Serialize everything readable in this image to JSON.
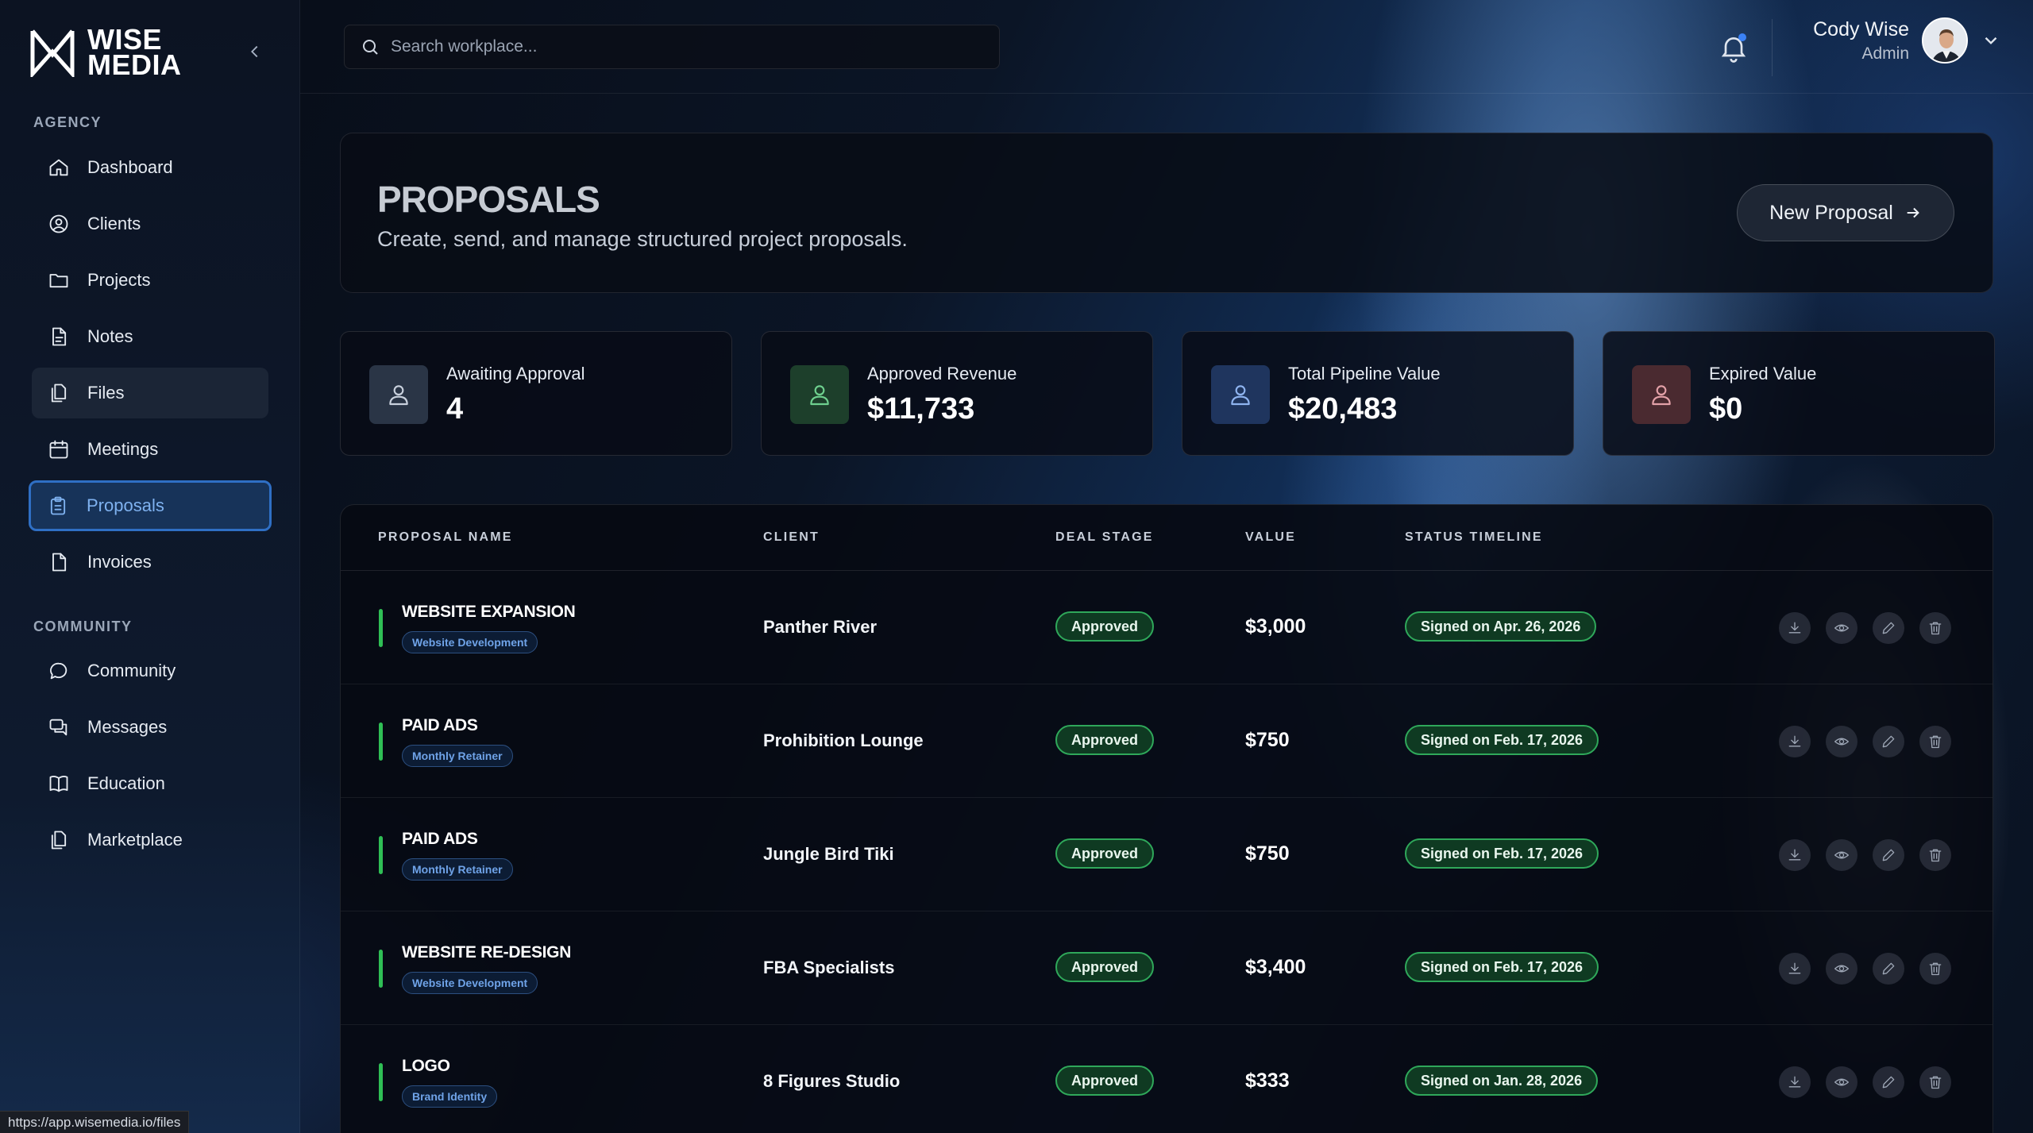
{
  "brand": {
    "line1": "WISE",
    "line2": "MEDIA"
  },
  "sidebar": {
    "agency_label": "AGENCY",
    "agency_items": [
      {
        "label": "Dashboard",
        "icon": "home-icon"
      },
      {
        "label": "Clients",
        "icon": "user-circle-icon"
      },
      {
        "label": "Projects",
        "icon": "folder-icon"
      },
      {
        "label": "Notes",
        "icon": "note-icon"
      },
      {
        "label": "Files",
        "icon": "files-icon"
      },
      {
        "label": "Meetings",
        "icon": "calendar-icon"
      },
      {
        "label": "Proposals",
        "icon": "clipboard-icon"
      },
      {
        "label": "Invoices",
        "icon": "document-icon"
      }
    ],
    "community_label": "COMMUNITY",
    "community_items": [
      {
        "label": "Community",
        "icon": "chat-bubble-icon"
      },
      {
        "label": "Messages",
        "icon": "messages-icon"
      },
      {
        "label": "Education",
        "icon": "book-icon"
      },
      {
        "label": "Marketplace",
        "icon": "marketplace-icon"
      }
    ],
    "active_item": "Proposals",
    "hover_item": "Files"
  },
  "search": {
    "placeholder": "Search workplace..."
  },
  "user": {
    "name": "Cody Wise",
    "role": "Admin"
  },
  "page": {
    "title": "PROPOSALS",
    "subtitle": "Create, send, and manage structured project proposals.",
    "new_button": "New Proposal"
  },
  "stats": [
    {
      "label": "Awaiting Approval",
      "value": "4",
      "accent": "#2a3546"
    },
    {
      "label": "Approved Revenue",
      "value": "$11,733",
      "accent": "#1d3f2b"
    },
    {
      "label": "Total Pipeline Value",
      "value": "$20,483",
      "accent": "#1f355e"
    },
    {
      "label": "Expired Value",
      "value": "$0",
      "accent": "#4a2a30"
    }
  ],
  "table": {
    "headers": [
      "PROPOSAL NAME",
      "CLIENT",
      "DEAL STAGE",
      "VALUE",
      "STATUS TIMELINE"
    ],
    "rows": [
      {
        "name": "WEBSITE EXPANSION",
        "tag": "Website Development",
        "client": "Panther River",
        "stage": "Approved",
        "value": "$3,000",
        "status": "Signed on Apr. 26, 2026"
      },
      {
        "name": "PAID ADS",
        "tag": "Monthly Retainer",
        "client": "Prohibition Lounge",
        "stage": "Approved",
        "value": "$750",
        "status": "Signed on Feb. 17, 2026"
      },
      {
        "name": "PAID ADS",
        "tag": "Monthly Retainer",
        "client": "Jungle Bird Tiki",
        "stage": "Approved",
        "value": "$750",
        "status": "Signed on Feb. 17, 2026"
      },
      {
        "name": "WEBSITE RE-DESIGN",
        "tag": "Website Development",
        "client": "FBA Specialists",
        "stage": "Approved",
        "value": "$3,400",
        "status": "Signed on Feb. 17, 2026"
      },
      {
        "name": "LOGO",
        "tag": "Brand Identity",
        "client": "8 Figures Studio",
        "stage": "Approved",
        "value": "$333",
        "status": "Signed on Jan. 28, 2026"
      }
    ],
    "row_actions": [
      "download-icon",
      "eye-icon",
      "pencil-icon",
      "trash-icon"
    ]
  },
  "status_bar": {
    "url": "https://app.wisemedia.io/files"
  },
  "colors": {
    "accent_blue": "#2f6fc4",
    "approved_green": "#2fa85a",
    "row_bar": "#2fbf55"
  }
}
